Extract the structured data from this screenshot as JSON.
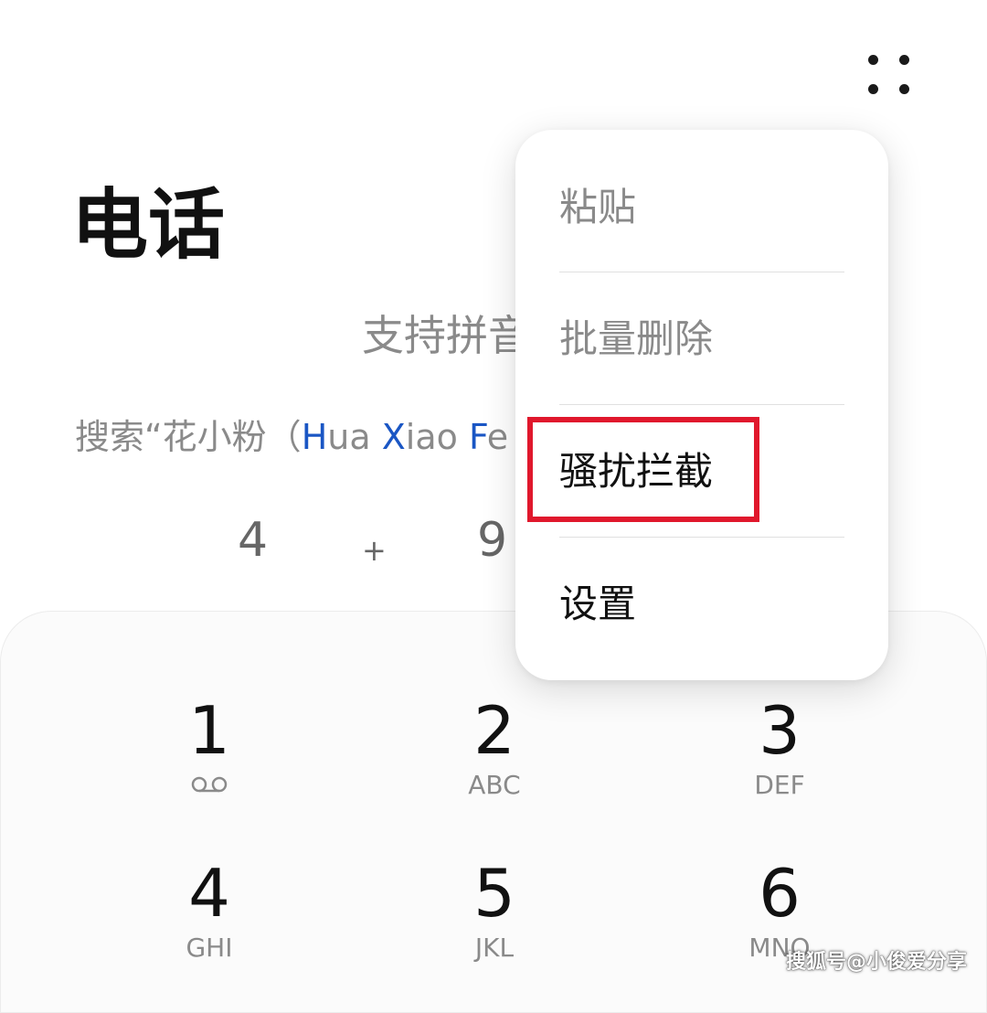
{
  "header": {
    "title": "电话",
    "more_icon": "more-dots-icon"
  },
  "hint": {
    "text": "支持拼音"
  },
  "search_example": {
    "prefix": "搜索“花小粉（",
    "h1": "H",
    "p1": "ua ",
    "h2": "X",
    "p2": "iao ",
    "h3": "F",
    "p3": "e"
  },
  "input_preview": {
    "chars": [
      "4",
      "+",
      "9"
    ]
  },
  "menu": {
    "items": [
      {
        "label": "粘贴",
        "enabled": false
      },
      {
        "label": "批量删除",
        "enabled": false
      },
      {
        "label": "骚扰拦截",
        "enabled": true
      },
      {
        "label": "设置",
        "enabled": true
      }
    ]
  },
  "keypad": {
    "keys": [
      {
        "digit": "1",
        "letters": "",
        "icon": "voicemail-icon"
      },
      {
        "digit": "2",
        "letters": "ABC"
      },
      {
        "digit": "3",
        "letters": "DEF"
      },
      {
        "digit": "4",
        "letters": "GHI"
      },
      {
        "digit": "5",
        "letters": "JKL"
      },
      {
        "digit": "6",
        "letters": "MNO"
      }
    ]
  },
  "annotation": {
    "highlight_color": "#e0182c"
  },
  "watermark": {
    "text": "搜狐号@小俊爱分享"
  }
}
